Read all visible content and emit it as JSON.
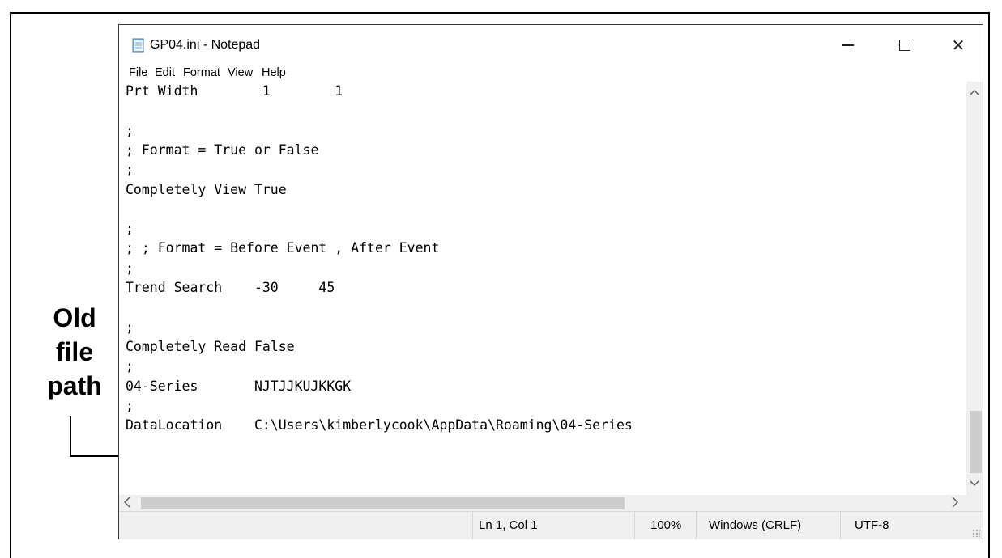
{
  "annotation": {
    "lines": [
      "Old",
      "file",
      "path"
    ]
  },
  "window": {
    "title": "GP04.ini - Notepad",
    "controls": {
      "minimize": "minimize",
      "maximize": "maximize",
      "close": "close"
    }
  },
  "menu": {
    "file": "File",
    "edit": "Edit",
    "format": "Format",
    "view": "View",
    "help": "Help"
  },
  "editor": {
    "lines": [
      "Prt Width        1        1",
      "",
      ";",
      "; Format = True or False",
      ";",
      "Completely View True",
      "",
      ";",
      "; ; Format = Before Event , After Event",
      ";",
      "Trend Search    -30     45",
      "",
      ";",
      "Completely Read False",
      ";",
      "04-Series       NJTJJKUJKKGK",
      ";",
      "DataLocation    C:\\Users\\kimberlycook\\AppData\\Roaming\\04-Series"
    ]
  },
  "statusbar": {
    "position": "Ln 1, Col 1",
    "zoom": "100%",
    "line_ending": "Windows (CRLF)",
    "encoding": "UTF-8"
  },
  "icons": {
    "app": "notepad-icon",
    "scroll_up": "chevron-up-icon",
    "scroll_down": "chevron-down-icon",
    "scroll_left": "chevron-left-icon",
    "scroll_right": "chevron-right-icon"
  }
}
